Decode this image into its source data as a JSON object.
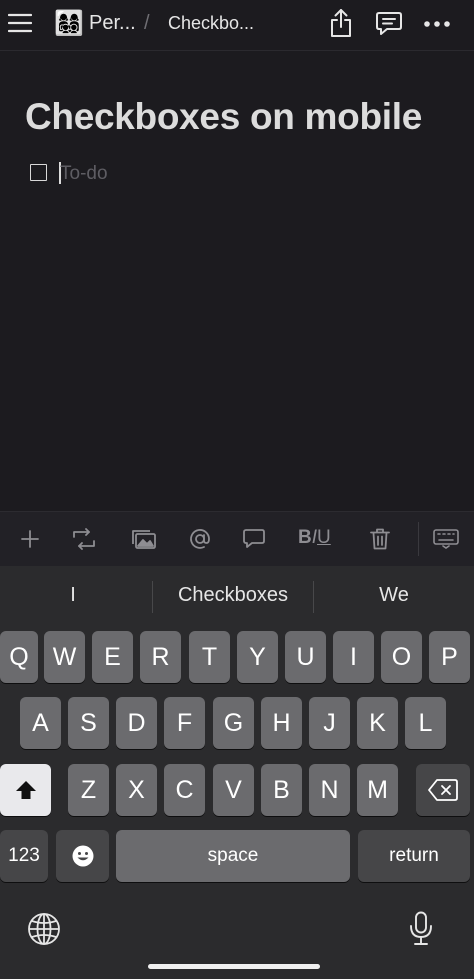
{
  "header": {
    "workspace_emoji": "👩‍👩‍👧‍👦",
    "breadcrumb_parent": "Per...",
    "breadcrumb_separator": "/",
    "breadcrumb_current": "Checkbo..."
  },
  "page": {
    "title": "Checkboxes on mobile",
    "todo_placeholder": "To-do",
    "todo_value": ""
  },
  "toolbar": {
    "items": [
      "add-block",
      "turn-into",
      "media",
      "mention",
      "comment",
      "text-format",
      "delete",
      "keyboard"
    ],
    "biu_b": "B",
    "biu_i": "I",
    "biu_u": "U"
  },
  "keyboard": {
    "suggestions": [
      "I",
      "Checkboxes",
      "We"
    ],
    "row1": [
      "Q",
      "W",
      "E",
      "R",
      "T",
      "Y",
      "U",
      "I",
      "O",
      "P"
    ],
    "row2": [
      "A",
      "S",
      "D",
      "F",
      "G",
      "H",
      "J",
      "K",
      "L"
    ],
    "row3": [
      "Z",
      "X",
      "C",
      "V",
      "B",
      "N",
      "M"
    ],
    "numbers_label": "123",
    "space_label": "space",
    "return_label": "return"
  },
  "colors": {
    "background": "#1c1b1f",
    "keyboard_bg": "#2b2b2d",
    "key_bg": "#6b6b6e"
  }
}
